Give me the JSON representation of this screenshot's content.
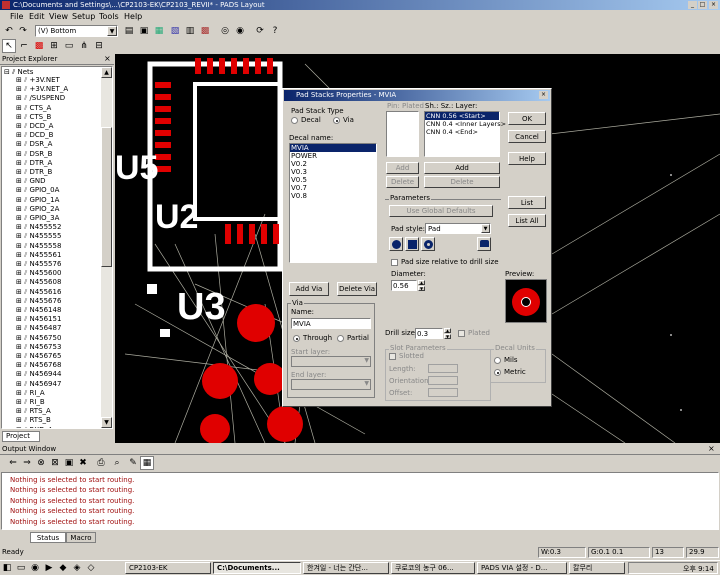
{
  "window": {
    "title": "C:\\Documents and Settings\\...\\CP2103-EK\\CP2103_REVII* - PADS Layout"
  },
  "menu": [
    "File",
    "Edit",
    "View",
    "Setup",
    "Tools",
    "Help"
  ],
  "toolbar": {
    "layer_select_value": "(V) Bottom"
  },
  "project_explorer": {
    "title": "Project Explorer",
    "root": "Nets",
    "nets": [
      "+3V.NET",
      "+3V.NET_A",
      "/SUSPEND",
      "CTS_A",
      "CTS_B",
      "DCD_A",
      "DCD_B",
      "DSR_A",
      "DSR_B",
      "DTR_A",
      "DTR_B",
      "GND",
      "GPIO_0A",
      "GPIO_1A",
      "GPIO_2A",
      "GPIO_3A",
      "N455552",
      "N455555",
      "N455558",
      "N455561",
      "N455576",
      "N455600",
      "N455608",
      "N455616",
      "N455676",
      "N456148",
      "N456151",
      "N456487",
      "N456750",
      "N456753",
      "N456765",
      "N456768",
      "N456944",
      "N456947",
      "RI_A",
      "RI_B",
      "RTS_A",
      "RTS_B",
      "RXD_A"
    ],
    "tab": "Project"
  },
  "canvas": {
    "labels": [
      "U5",
      "U2",
      "U3"
    ]
  },
  "dialog": {
    "title": "Pad Stacks Properties - MVIA",
    "pad_stack_type_label": "Pad Stack Type",
    "decal_radio": "Decal",
    "via_radio": "Via",
    "decal_name_label": "Decal name:",
    "decals": [
      "MVIA",
      "POWER",
      "V0.2",
      "V0.3",
      "V0.5",
      "V0.7",
      "V0.8"
    ],
    "selected_decal": "MVIA",
    "pin_plated_header": "Pin: Plated",
    "sh_sz_layer_header": "Sh.: Sz.: Layer:",
    "layers": [
      "CNN 0.56 <Start>",
      "CNN 0.4 <Inner Layers>",
      "CNN 0.4 <End>"
    ],
    "add_via_button": "Add Via",
    "delete_via_button": "Delete Via",
    "via_group_label": "Via",
    "name_label": "Name:",
    "name_value": "MVIA",
    "through_radio": "Through",
    "partial_radio": "Partial",
    "start_layer_label": "Start layer:",
    "end_layer_label": "End layer:",
    "pin_add_button": "Add",
    "pin_delete_button": "Delete",
    "layer_add_button": "Add",
    "layer_delete_button": "Delete",
    "ok_button": "OK",
    "cancel_button": "Cancel",
    "help_button": "Help",
    "list_button": "List",
    "list_all_button": "List All",
    "parameters_label": "Parameters",
    "use_global_defaults_button": "Use Global Defaults",
    "pad_style_label": "Pad style:",
    "pad_style_value": "Pad",
    "pad_size_checkbox": "Pad size relative to drill size",
    "diameter_label": "Diameter:",
    "diameter_value": "0.56",
    "preview_label": "Preview:",
    "drill_size_label": "Drill size:",
    "drill_size_value": "0.3",
    "plated_checkbox": "Plated",
    "slot_parameters_label": "Slot Parameters",
    "slotted_checkbox": "Slotted",
    "length_label": "Length:",
    "orientation_label": "Orientation:",
    "offset_label": "Offset:",
    "decal_units_label": "Decal Units",
    "mils_radio": "Mils",
    "metric_radio": "Metric"
  },
  "output": {
    "title": "Output Window",
    "lines": [
      "Nothing is selected to start routing.",
      "Nothing is selected to start routing.",
      "Nothing is selected to start routing.",
      "Nothing is selected to start routing.",
      "Nothing is selected to start routing."
    ],
    "tabs": [
      "Status",
      "Macro"
    ]
  },
  "statusbar": {
    "ready": "Ready",
    "w": "W:0.3",
    "g": "G:0.1 0.1",
    "x": "13",
    "y": "29.9"
  },
  "taskbar": {
    "items": [
      "CP2103-EK",
      "C:\\Documents...",
      "한겨일 - 너는 간단...",
      "쿠로코의 농구 06...",
      "PADS VIA 설정 - D...",
      "칼무리"
    ],
    "clock": "오후 9:14"
  }
}
